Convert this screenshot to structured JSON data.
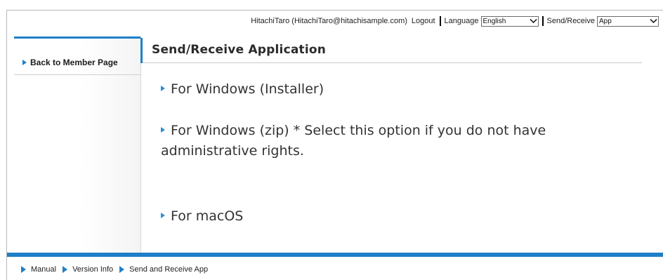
{
  "header": {
    "user": "HitachiTaro (HitachiTaro@hitachisample.com)",
    "logout": "Logout",
    "language_label": "Language",
    "language_value": "English",
    "sendreceive_label": "Send/Receive",
    "sendreceive_value": "App"
  },
  "sidebar": {
    "back_link": "Back to Member Page"
  },
  "main": {
    "title": "Send/Receive Application",
    "items": [
      {
        "label": "For Windows (Installer)"
      },
      {
        "label": "For Windows (zip) * Select this option if you do not have administrative rights."
      },
      {
        "label": "For macOS"
      }
    ]
  },
  "footer": {
    "links": [
      {
        "label": "Manual"
      },
      {
        "label": "Version Info"
      },
      {
        "label": "Send and Receive App"
      }
    ]
  },
  "colors": {
    "accent": "#1f7fc7",
    "text": "#333333"
  }
}
